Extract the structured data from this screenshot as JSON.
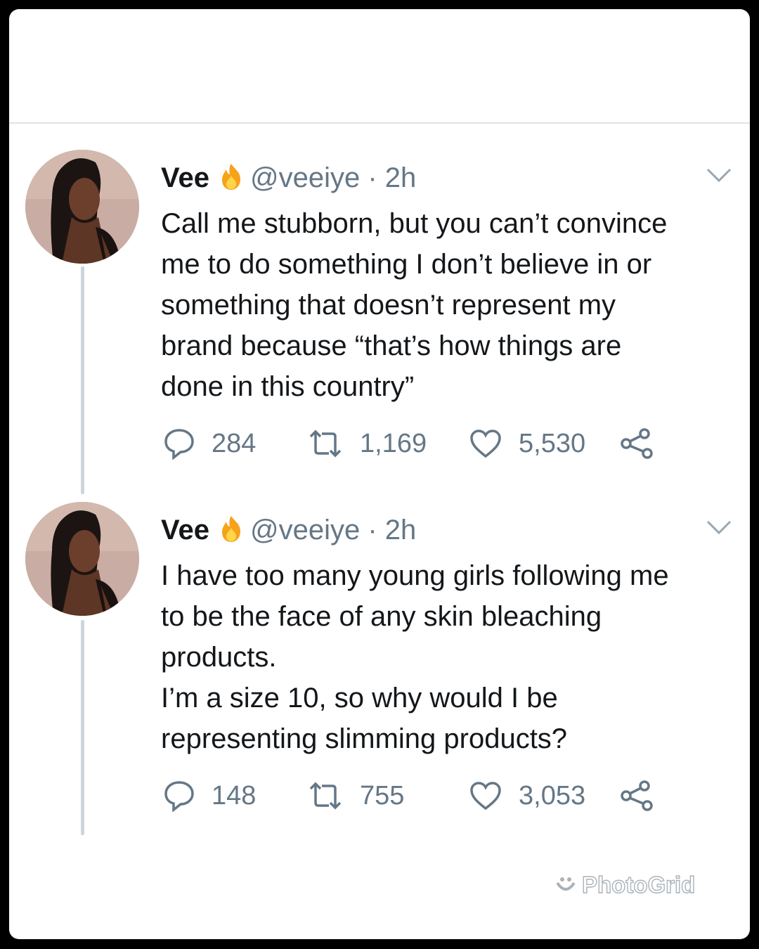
{
  "tweets": [
    {
      "name": "Vee",
      "handle_time": "@veeiye · 2h",
      "text": "Call me stubborn, but you can’t convince\nme to do something I don’t believe in or\nsomething that doesn’t represent my\nbrand because “that’s how things are\ndone in this country”",
      "replies": "284",
      "retweets": "1,169",
      "likes": "5,530"
    },
    {
      "name": "Vee",
      "handle_time": "@veeiye · 2h",
      "text": "I have too many young girls following me\nto be the face of any skin bleaching\nproducts.\nI’m a size 10, so why would I be\nrepresenting slimming products?",
      "replies": "148",
      "retweets": "755",
      "likes": "3,053"
    }
  ],
  "watermark": "PhotoGrid",
  "colors": {
    "text": "#14171a",
    "secondary": "#657786",
    "thread_line": "#cdd6dd",
    "fire": "#f7a21b"
  },
  "icons": [
    "fire-emoji-icon",
    "chevron-down-icon",
    "reply-icon",
    "retweet-icon",
    "like-icon",
    "share-icon"
  ]
}
